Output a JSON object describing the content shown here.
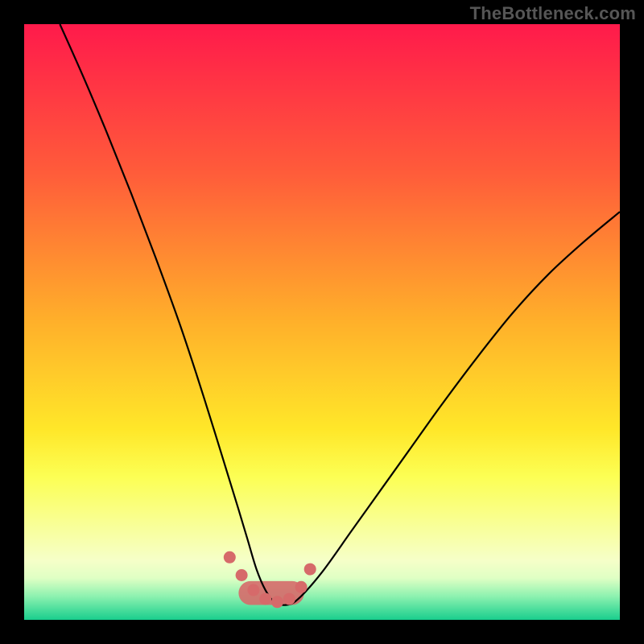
{
  "watermark": "TheBottleneck.com",
  "colors": {
    "gradient_top": "#ff1a4b",
    "gradient_25": "#ff5c3a",
    "gradient_50": "#ffb02a",
    "gradient_68": "#ffe729",
    "gradient_76": "#fcff54",
    "gradient_90": "#f6ffc8",
    "gradient_93": "#dfffc4",
    "gradient_96": "#8ef2b0",
    "gradient_bottom": "#19ce8d",
    "curve": "#000000",
    "accent": "#d66a6a"
  },
  "chart_data": {
    "type": "line",
    "title": "",
    "xlabel": "",
    "ylabel": "",
    "xlim": [
      0,
      100
    ],
    "ylim": [
      0,
      100
    ],
    "grid": false,
    "legend": false,
    "series": [
      {
        "name": "bottleneck-curve",
        "x": [
          6,
          10,
          14,
          18,
          22,
          26,
          29,
          32,
          34,
          36,
          37.5,
          39,
          40.5,
          42,
          44,
          46,
          50,
          55,
          60,
          65,
          70,
          76,
          82,
          88,
          94,
          100
        ],
        "y": [
          100,
          91,
          81.5,
          71.5,
          61,
          50,
          41,
          31.5,
          25,
          18.5,
          13.5,
          8.5,
          5,
          3,
          2.5,
          3.5,
          8,
          15,
          22,
          29,
          36,
          44,
          51.5,
          58,
          63.5,
          68.5
        ]
      }
    ],
    "accent_points": {
      "name": "accent-dots",
      "x": [
        34.5,
        36.5,
        38.5,
        40.5,
        42.5,
        44.5,
        46.5,
        48
      ],
      "y": [
        10.5,
        7.5,
        5,
        3.5,
        3,
        3.5,
        5.5,
        8.5
      ]
    },
    "accent_band_y": [
      2.5,
      6.5
    ]
  }
}
